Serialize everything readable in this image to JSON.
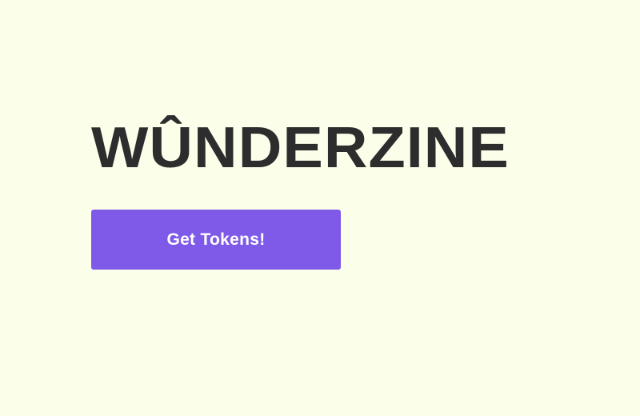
{
  "brand": {
    "title": "WÛNDERZINE"
  },
  "actions": {
    "get_tokens_label": "Get Tokens!"
  },
  "colors": {
    "background": "#fbffea",
    "title_text": "#2d2d2d",
    "button_background": "#7f5ae9",
    "button_text": "#ffffff"
  }
}
